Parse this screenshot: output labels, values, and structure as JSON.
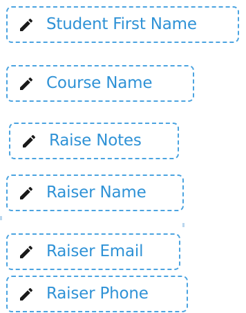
{
  "fields": [
    {
      "label": "Student First Name",
      "icon": "pencil-icon"
    },
    {
      "label": "Course Name",
      "icon": "pencil-icon"
    },
    {
      "label": "Raise Notes",
      "icon": "pencil-icon"
    },
    {
      "label": "Raiser Name",
      "icon": "pencil-icon"
    },
    {
      "label": "Raiser Email",
      "icon": "pencil-icon"
    },
    {
      "label": "Raiser Phone",
      "icon": "pencil-icon"
    }
  ],
  "colors": {
    "border": "#4aa3e0",
    "label": "#2f92d6",
    "icon": "#1a1a1a",
    "background": "#ffffff"
  }
}
